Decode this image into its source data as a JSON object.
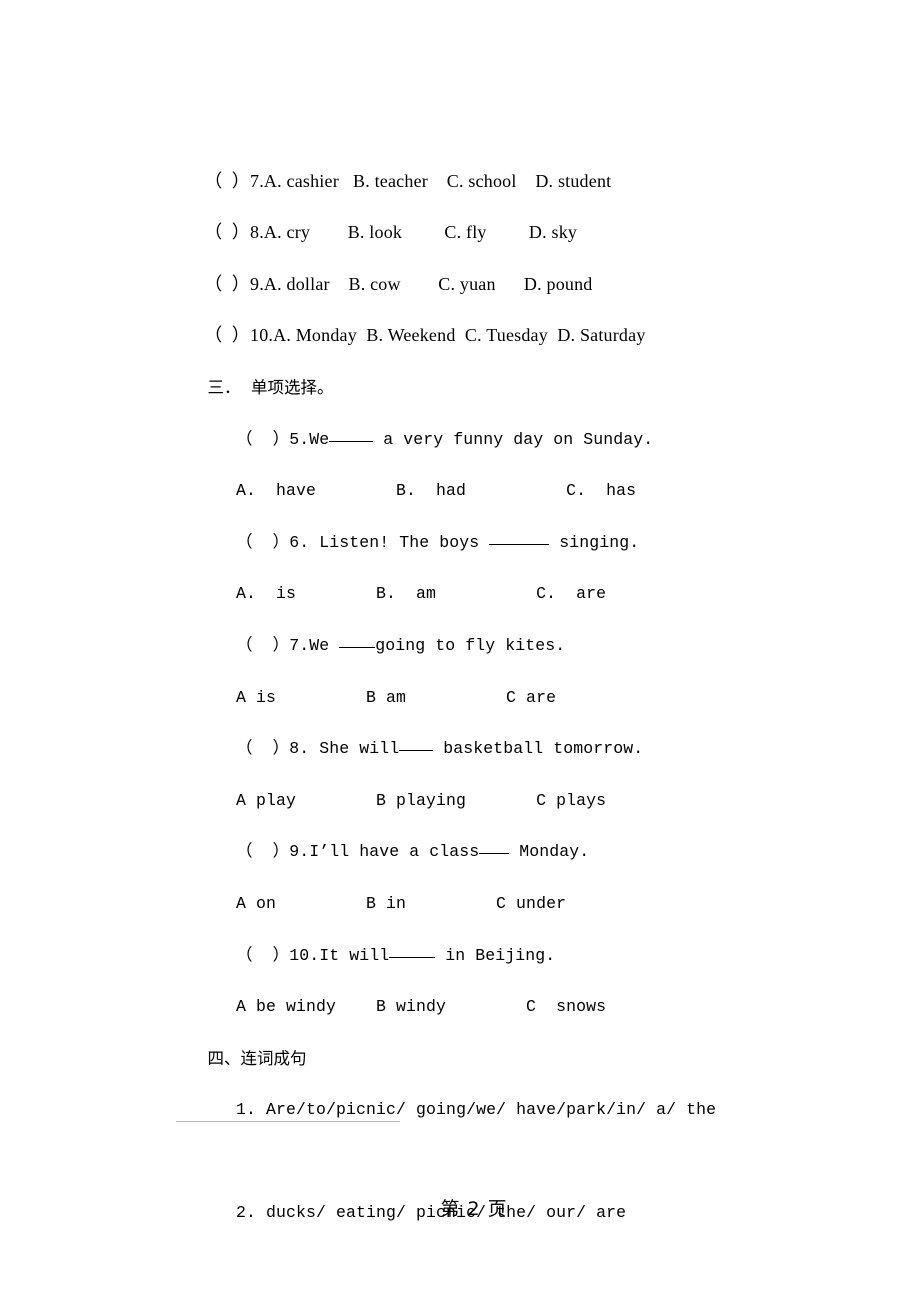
{
  "document": {
    "page_footer": "第 2 页",
    "page_number": "2"
  },
  "matching_tail": {
    "items": [
      {
        "marker": "（  ）",
        "number": "7.",
        "options": "A. cashier   B. teacher    C. school    D. student"
      },
      {
        "marker": "（  ）",
        "number": "8.",
        "options": "A. cry        B. look         C. fly         D. sky"
      },
      {
        "marker": "（  ）",
        "number": "9.",
        "options": "A. dollar    B. cow        C. yuan      D. pound"
      },
      {
        "marker": "（  ）",
        "number": "10.",
        "options": "A. Monday  B. Weekend  C. Tuesday  D. Saturday"
      }
    ]
  },
  "section_three": {
    "heading": "三．  单项选择。",
    "questions": [
      {
        "marker": "（  ）",
        "number": "5.",
        "before": "We",
        "after": " a very funny day on Sunday.",
        "options": "A.  have        B.  had          C.  has"
      },
      {
        "marker": "（  ）",
        "number": "6.",
        "before": " Listen! The boys ",
        "after": " singing.",
        "options": "A.  is        B.  am          C.  are"
      },
      {
        "marker": "（  ）",
        "number": "7.",
        "before": "We ",
        "after": "going to fly kites.",
        "options": "A is         B am          C are"
      },
      {
        "marker": "（  ）",
        "number": "8.",
        "before": " She will",
        "after": " basketball tomorrow.",
        "options": "A play        B playing       C plays"
      },
      {
        "marker": "（  ）",
        "number": "9.",
        "before": "I’ll have a class",
        "after": " Monday.",
        "options": "A on         B in         C under"
      },
      {
        "marker": "（  ）",
        "number": "10.",
        "before": "It will",
        "after": " in Beijing.",
        "options": "A be windy    B windy        C  snows"
      }
    ]
  },
  "section_four": {
    "heading": "四、连词成句",
    "items": [
      {
        "number": "1.",
        "words": " Are/to/picnic/ going/we/ have/park/in/ a/ the"
      },
      {
        "number": "2.",
        "words": " ducks/ eating/ picnic/ the/ our/ are"
      }
    ]
  }
}
